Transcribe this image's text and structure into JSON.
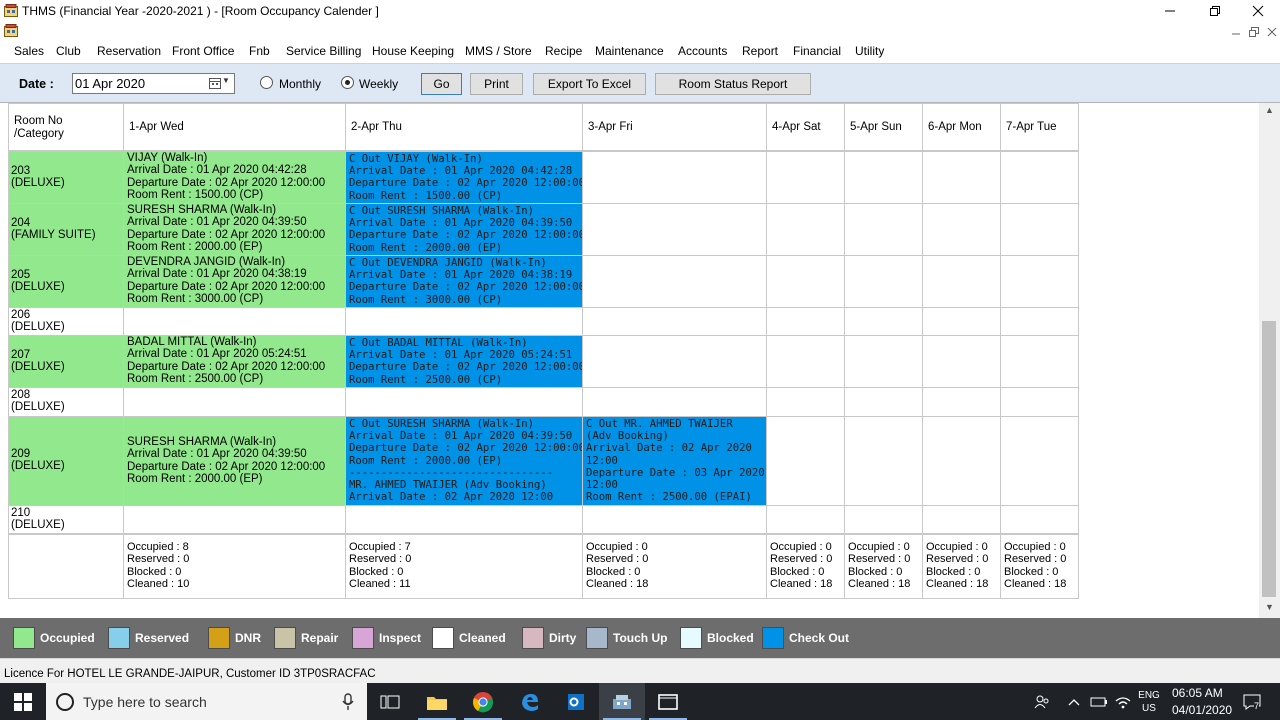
{
  "window": {
    "title": "THMS (Financial Year -2020-2021 ) - [Room Occupancy Calender ]",
    "controls": {
      "minimize": "—",
      "maximize": "❐",
      "close": "✕"
    }
  },
  "menu": {
    "items": [
      "Sales",
      "Club",
      "Reservation",
      "Front Office",
      "Fnb",
      "Service Billing",
      "House Keeping",
      "MMS / Store",
      "Recipe",
      "Maintenance",
      "Accounts",
      "Report",
      "Financial",
      "Utility"
    ],
    "mdi_controls": {
      "minimize": "‒",
      "restore": "❐",
      "close": "✕"
    }
  },
  "toolbar": {
    "date_label": "Date :",
    "date_value": "01 Apr 2020",
    "radio_monthly": "Monthly",
    "radio_weekly": "Weekly",
    "selected_view": "Weekly",
    "go": "Go",
    "print": "Print",
    "export": "Export To Excel",
    "room_status": "Room Status Report"
  },
  "grid": {
    "headers": [
      "Room No\n/Category",
      "1-Apr Wed",
      "2-Apr Thu",
      "3-Apr Fri",
      "4-Apr Sat",
      "5-Apr Sun",
      "6-Apr Mon",
      "7-Apr Tue"
    ],
    "rows": [
      {
        "room": "203\n(DELUXE)",
        "cells": [
          {
            "status": "occupied",
            "text": "VIJAY (Walk-In)\nArrival Date : 01 Apr 2020 04:42:28\nDeparture Date : 02 Apr 2020 12:00:00\nRoom Rent : 1500.00 (CP)"
          },
          {
            "status": "checkout",
            "text": "C Out VIJAY (Walk-In)\nArrival Date : 01 Apr 2020 04:42:28\nDeparture Date : 02 Apr 2020 12:00:00\nRoom Rent : 1500.00 (CP)"
          },
          {
            "status": "empty",
            "text": ""
          },
          {
            "status": "empty",
            "text": ""
          },
          {
            "status": "empty",
            "text": ""
          },
          {
            "status": "empty",
            "text": ""
          },
          {
            "status": "empty",
            "text": ""
          }
        ]
      },
      {
        "room": "204\n(FAMILY SUITE)",
        "cells": [
          {
            "status": "occupied",
            "text": "SURESH SHARMA (Walk-In)\nArrival Date : 01 Apr 2020 04:39:50\nDeparture Date : 02 Apr 2020 12:00:00\nRoom Rent : 2000.00 (EP)"
          },
          {
            "status": "checkout",
            "text": "C Out SURESH SHARMA (Walk-In)\nArrival Date : 01 Apr 2020 04:39:50\nDeparture Date : 02 Apr 2020 12:00:00\nRoom Rent : 2000.00 (EP)"
          },
          {
            "status": "empty",
            "text": ""
          },
          {
            "status": "empty",
            "text": ""
          },
          {
            "status": "empty",
            "text": ""
          },
          {
            "status": "empty",
            "text": ""
          },
          {
            "status": "empty",
            "text": ""
          }
        ]
      },
      {
        "room": "205\n(DELUXE)",
        "cells": [
          {
            "status": "occupied",
            "text": "DEVENDRA JANGID (Walk-In)\nArrival Date : 01 Apr 2020 04:38:19\nDeparture Date : 02 Apr 2020 12:00:00\nRoom Rent : 3000.00 (CP)"
          },
          {
            "status": "checkout",
            "text": "C Out DEVENDRA JANGID (Walk-In)\nArrival Date : 01 Apr 2020 04:38:19\nDeparture Date : 02 Apr 2020 12:00:00\nRoom Rent : 3000.00 (CP)"
          },
          {
            "status": "empty",
            "text": ""
          },
          {
            "status": "empty",
            "text": ""
          },
          {
            "status": "empty",
            "text": ""
          },
          {
            "status": "empty",
            "text": ""
          },
          {
            "status": "empty",
            "text": ""
          }
        ]
      },
      {
        "room": "206\n(DELUXE)",
        "cells": [
          {
            "status": "empty",
            "text": ""
          },
          {
            "status": "empty",
            "text": ""
          },
          {
            "status": "empty",
            "text": ""
          },
          {
            "status": "empty",
            "text": ""
          },
          {
            "status": "empty",
            "text": ""
          },
          {
            "status": "empty",
            "text": ""
          },
          {
            "status": "empty",
            "text": ""
          }
        ]
      },
      {
        "room": "207\n(DELUXE)",
        "cells": [
          {
            "status": "occupied",
            "text": "BADAL MITTAL (Walk-In)\nArrival Date : 01 Apr 2020 05:24:51\nDeparture Date : 02 Apr 2020 12:00:00\nRoom Rent : 2500.00 (CP)"
          },
          {
            "status": "checkout",
            "text": "C Out BADAL MITTAL (Walk-In)\nArrival Date : 01 Apr 2020 05:24:51\nDeparture Date : 02 Apr 2020 12:00:00\nRoom Rent : 2500.00 (CP)"
          },
          {
            "status": "empty",
            "text": ""
          },
          {
            "status": "empty",
            "text": ""
          },
          {
            "status": "empty",
            "text": ""
          },
          {
            "status": "empty",
            "text": ""
          },
          {
            "status": "empty",
            "text": ""
          }
        ]
      },
      {
        "room": "208\n(DELUXE)",
        "cells": [
          {
            "status": "empty",
            "text": ""
          },
          {
            "status": "empty",
            "text": ""
          },
          {
            "status": "empty",
            "text": ""
          },
          {
            "status": "empty",
            "text": ""
          },
          {
            "status": "empty",
            "text": ""
          },
          {
            "status": "empty",
            "text": ""
          },
          {
            "status": "empty",
            "text": ""
          }
        ]
      },
      {
        "room": "209\n(DELUXE)",
        "cells": [
          {
            "status": "occupied",
            "text": "SURESH SHARMA (Walk-In)\nArrival Date : 01 Apr 2020 04:39:50\nDeparture Date : 02 Apr 2020 12:00:00\nRoom Rent : 2000.00 (EP)"
          },
          {
            "status": "checkout",
            "text": "C Out SURESH SHARMA (Walk-In)\nArrival Date : 01 Apr 2020 04:39:50\nDeparture Date : 02 Apr 2020 12:00:00\nRoom Rent : 2000.00 (EP)\n--------------------------------\nMR. AHMED TWAIJER (Adv Booking)\nArrival Date : 02 Apr 2020 12:00"
          },
          {
            "status": "checkout",
            "text": "C Out MR. AHMED TWAIJER\n(Adv Booking)\nArrival Date : 02 Apr 2020\n12:00\nDeparture Date : 03 Apr 2020\n12:00\nRoom Rent : 2500.00 (EPAI)"
          },
          {
            "status": "empty",
            "text": ""
          },
          {
            "status": "empty",
            "text": ""
          },
          {
            "status": "empty",
            "text": ""
          },
          {
            "status": "empty",
            "text": ""
          }
        ]
      },
      {
        "room": "210\n(DELUXE)",
        "cells": [
          {
            "status": "empty",
            "text": ""
          },
          {
            "status": "empty",
            "text": ""
          },
          {
            "status": "empty",
            "text": ""
          },
          {
            "status": "empty",
            "text": ""
          },
          {
            "status": "empty",
            "text": ""
          },
          {
            "status": "empty",
            "text": ""
          },
          {
            "status": "empty",
            "text": ""
          }
        ]
      }
    ],
    "summary": [
      "Occupied : 8\nReserved : 0\nBlocked : 0\nCleaned : 10",
      "Occupied : 7\nReserved : 0\nBlocked : 0\nCleaned : 11",
      "Occupied : 0\nReserved : 0\nBlocked : 0\nCleaned : 18",
      "Occupied : 0\nReserved : 0\nBlocked : 0\nCleaned : 18",
      "Occupied : 0\nReserved : 0\nBlocked : 0\nCleaned : 18",
      "Occupied : 0\nReserved : 0\nBlocked : 0\nCleaned : 18",
      "Occupied : 0\nReserved : 0\nBlocked : 0\nCleaned : 18"
    ]
  },
  "legend": [
    {
      "label": "Occupied",
      "color": "#92e88c"
    },
    {
      "label": "Reserved",
      "color": "#87ceeb"
    },
    {
      "label": "DNR",
      "color": "#d4a017"
    },
    {
      "label": "Repair",
      "color": "#c9c3a8"
    },
    {
      "label": "Inspect",
      "color": "#d7a5d6"
    },
    {
      "label": "Cleaned",
      "color": "#ffffff"
    },
    {
      "label": "Dirty",
      "color": "#d8b8c0"
    },
    {
      "label": "Touch Up",
      "color": "#a8b8cc"
    },
    {
      "label": "Blocked",
      "color": "#e6fbff"
    },
    {
      "label": "Check Out",
      "color": "#0092e6"
    }
  ],
  "status_bar": {
    "text": "Licence For HOTEL LE GRANDE-JAIPUR, Customer ID 3TP0SRACFAC"
  },
  "taskbar": {
    "search_placeholder": "Type here to search",
    "tray_lang": "ENG",
    "tray_region": "US",
    "clock_time": "06:05 AM",
    "clock_date": "04/01/2020",
    "notification_count": "7",
    "apps": [
      "task-view",
      "file-explorer",
      "chrome",
      "edge",
      "outlook",
      "hotel-app",
      "window"
    ]
  }
}
